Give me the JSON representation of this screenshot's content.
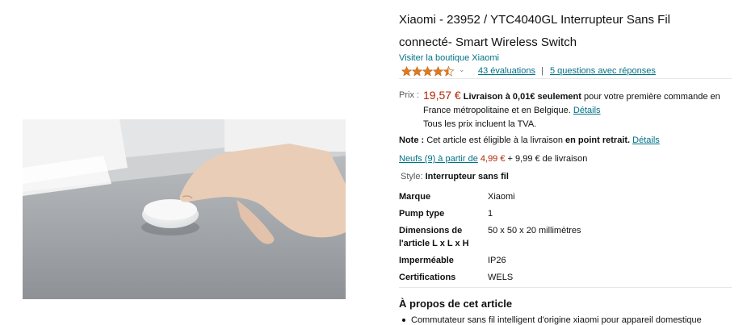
{
  "product": {
    "title": "Xiaomi - 23952 / YTC4040GL Interrupteur Sans Fil connecté- Smart Wireless Switch",
    "store_link": "Visiter la boutique Xiaomi",
    "rating": {
      "stars": 4.5,
      "count_text": "43 évaluations",
      "separator": "|",
      "qa_text": "5 questions avec réponses"
    }
  },
  "pricing": {
    "label": "Prix :",
    "price": "19,57 €",
    "delivery_bold": "Livraison à 0,01€ seulement",
    "delivery_text": " pour votre première commande en France métropolitaine et en Belgique.",
    "details_link": "Détails",
    "tva_text": "Tous les prix incluent la TVA."
  },
  "note": {
    "label": "Note :",
    "text": " Cet article est éligible à la livraison ",
    "bold": "en point retrait.",
    "link": "Détails"
  },
  "offers": {
    "link": "Neufs (9) à partir de",
    "price": "4,99 €",
    "shipping": "+ 9,99 € de livraison"
  },
  "style": {
    "label": "Style:",
    "value": "Interrupteur sans fil"
  },
  "specs": [
    {
      "key": "Marque",
      "value": "Xiaomi"
    },
    {
      "key": "Pump type",
      "value": "1"
    },
    {
      "key": "Dimensions de l'article L x L x H",
      "value": "50 x 50 x 20 millimètres"
    },
    {
      "key": "Imperméable",
      "value": "IP26"
    },
    {
      "key": "Certifications",
      "value": "WELS"
    }
  ],
  "about": {
    "heading": "À propos de cet article",
    "bullets": [
      "Commutateur sans fil intelligent d'origine xiaomi pour appareil domestique"
    ]
  },
  "icons": {
    "star": "star-icon",
    "chevron": "chevron-down-icon"
  },
  "colors": {
    "link": "#007185",
    "price": "#b12704",
    "star": "#de7921"
  }
}
